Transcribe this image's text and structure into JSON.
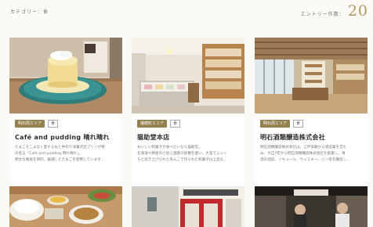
{
  "header": {
    "category": "カテゴリー：食",
    "entry_label": "エントリー作数：",
    "entry_count": "20"
  },
  "cards": [
    {
      "tag_area": "明石周エリア",
      "tag_cat": "食",
      "title": "Café and pudding 晴れ晴れ",
      "desc": [
        "たまごそこよなく愛するおと仲作り洋菓子店プリンが特",
        "の名る「Café and pudding 晴れ晴れ」。",
        "明太な看板を目印、厳選したたまごを使用しています…"
      ]
    },
    {
      "tag_area": "播磨町エリア",
      "tag_cat": "食",
      "title": "猫助堂本店",
      "desc": [
        "おいしい和菓子が食べたいなら猫助堂。",
        "北海道十勝産の小豆と国産の砂糖を使い、大釜でふっく",
        "らと炊き上げられたあんこで作られた和菓子は上品な…"
      ]
    },
    {
      "tag_area": "明石周エリア",
      "tag_cat": "食",
      "title": "明石酒類醸造株式会社",
      "desc": [
        "明石酒類醸造株式会社は、江戸末期から酒造業を営む",
        "み、大正7年から明石酒類醸造株式会社を創業し、清",
        "酒の酒造、リキュール、ウィスキー、ジン等を醸造し…"
      ]
    }
  ]
}
